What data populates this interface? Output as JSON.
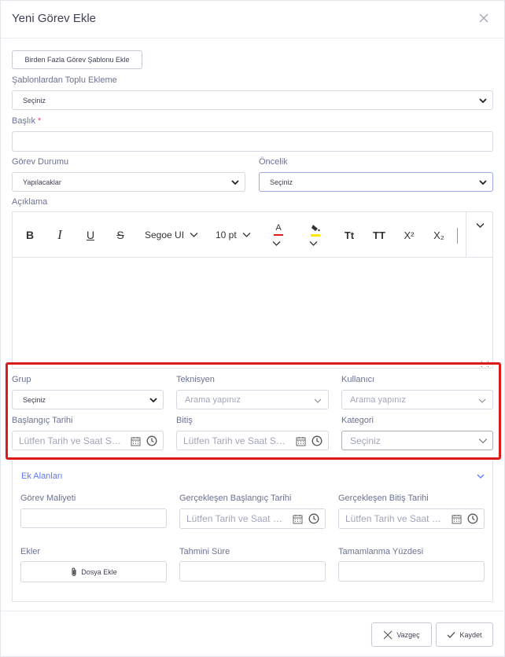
{
  "modal": {
    "title": "Yeni Görev Ekle",
    "close_icon": "close-icon"
  },
  "template_button": {
    "label": "Birden Fazla Görev Şablonu Ekle"
  },
  "bulk_template": {
    "label": "Şablonlardan Toplu Ekleme",
    "value": "Seçiniz"
  },
  "baslik": {
    "label": "Başlık",
    "required_mark": "*",
    "value": ""
  },
  "gorev_durumu": {
    "label": "Görev Durumu",
    "value": "Yapılacaklar"
  },
  "oncelik": {
    "label": "Öncelik",
    "value": "Seçiniz"
  },
  "aciklama": {
    "label": "Açıklama",
    "toolbar": {
      "bold": "B",
      "italic": "I",
      "underline": "U",
      "strikethrough": "S",
      "font_family": "Segoe UI",
      "font_size": "10 pt",
      "font_color_letter": "A",
      "font_color": "#e01b1b",
      "highlight_color": "#ffe600",
      "lowercase": "Tt",
      "uppercase": "TT",
      "superscript": "X²",
      "subscript": "X₂"
    },
    "body": ""
  },
  "grup": {
    "label": "Grup",
    "value": "Seçiniz"
  },
  "teknisyen": {
    "label": "Teknisyen",
    "placeholder": "Arama yapınız"
  },
  "kullanici": {
    "label": "Kullanıcı",
    "placeholder": "Arama yapınız"
  },
  "baslangic_tarihi": {
    "label": "Başlangıç Tarihi",
    "placeholder": "Lütfen Tarih ve Saat Seçiniz"
  },
  "bitis": {
    "label": "Bitiş",
    "placeholder": "Lütfen Tarih ve Saat Seçiniz"
  },
  "kategori": {
    "label": "Kategori",
    "value": "Seçiniz"
  },
  "ek_alanlar": {
    "title": "Ek Alanları",
    "gorev_maliyeti": {
      "label": "Görev Maliyeti",
      "value": ""
    },
    "gerceklesen_baslangic": {
      "label": "Gerçekleşen Başlangıç Tarihi",
      "placeholder": "Lütfen Tarih ve Saat Seçiniz"
    },
    "gerceklesen_bitis": {
      "label": "Gerçekleşen Bitiş Tarihi",
      "placeholder": "Lütfen Tarih ve Saat Seçiniz"
    },
    "ekler": {
      "label": "Ekler",
      "button": "Dosya Ekle"
    },
    "tahmini_sure": {
      "label": "Tahmini Süre",
      "value": ""
    },
    "tamamlanma_yuzdesi": {
      "label": "Tamamlanma Yüzdesi",
      "value": ""
    }
  },
  "footer": {
    "cancel": "Vazgeç",
    "save": "Kaydet"
  },
  "colors": {
    "accent": "#5d78ff",
    "highlight_border": "#dd1a1a"
  }
}
